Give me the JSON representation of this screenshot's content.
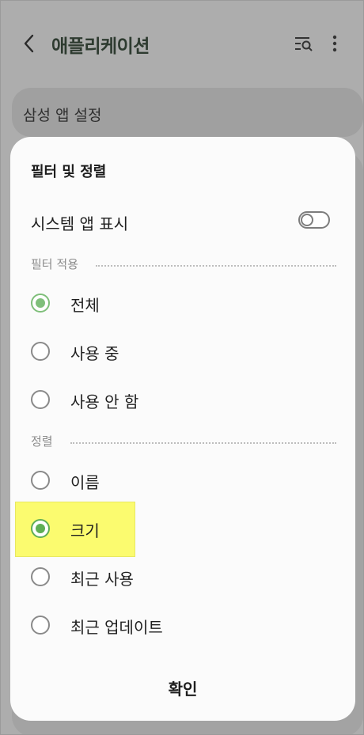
{
  "appbar": {
    "title": "애플리케이션"
  },
  "settings_card": {
    "label": "삼성 앱 설정"
  },
  "sheet": {
    "title": "필터 및 정렬",
    "system_apps": {
      "label": "시스템 앱 표시",
      "enabled": false
    },
    "filter_section": {
      "label": "필터 적용",
      "options": [
        {
          "label": "전체",
          "selected": true
        },
        {
          "label": "사용 중",
          "selected": false
        },
        {
          "label": "사용 안 함",
          "selected": false
        }
      ]
    },
    "sort_section": {
      "label": "정렬",
      "options": [
        {
          "label": "이름",
          "selected": false
        },
        {
          "label": "크기",
          "selected": true
        },
        {
          "label": "최근 사용",
          "selected": false
        },
        {
          "label": "최근 업데이트",
          "selected": false
        }
      ]
    },
    "confirm_label": "확인"
  },
  "colors": {
    "accent": "#5fae55",
    "highlight": "#fbfb6f",
    "dim_background": "#adadad"
  },
  "icons": [
    "back-arrow-icon",
    "list-search-icon",
    "more-vertical-icon"
  ]
}
